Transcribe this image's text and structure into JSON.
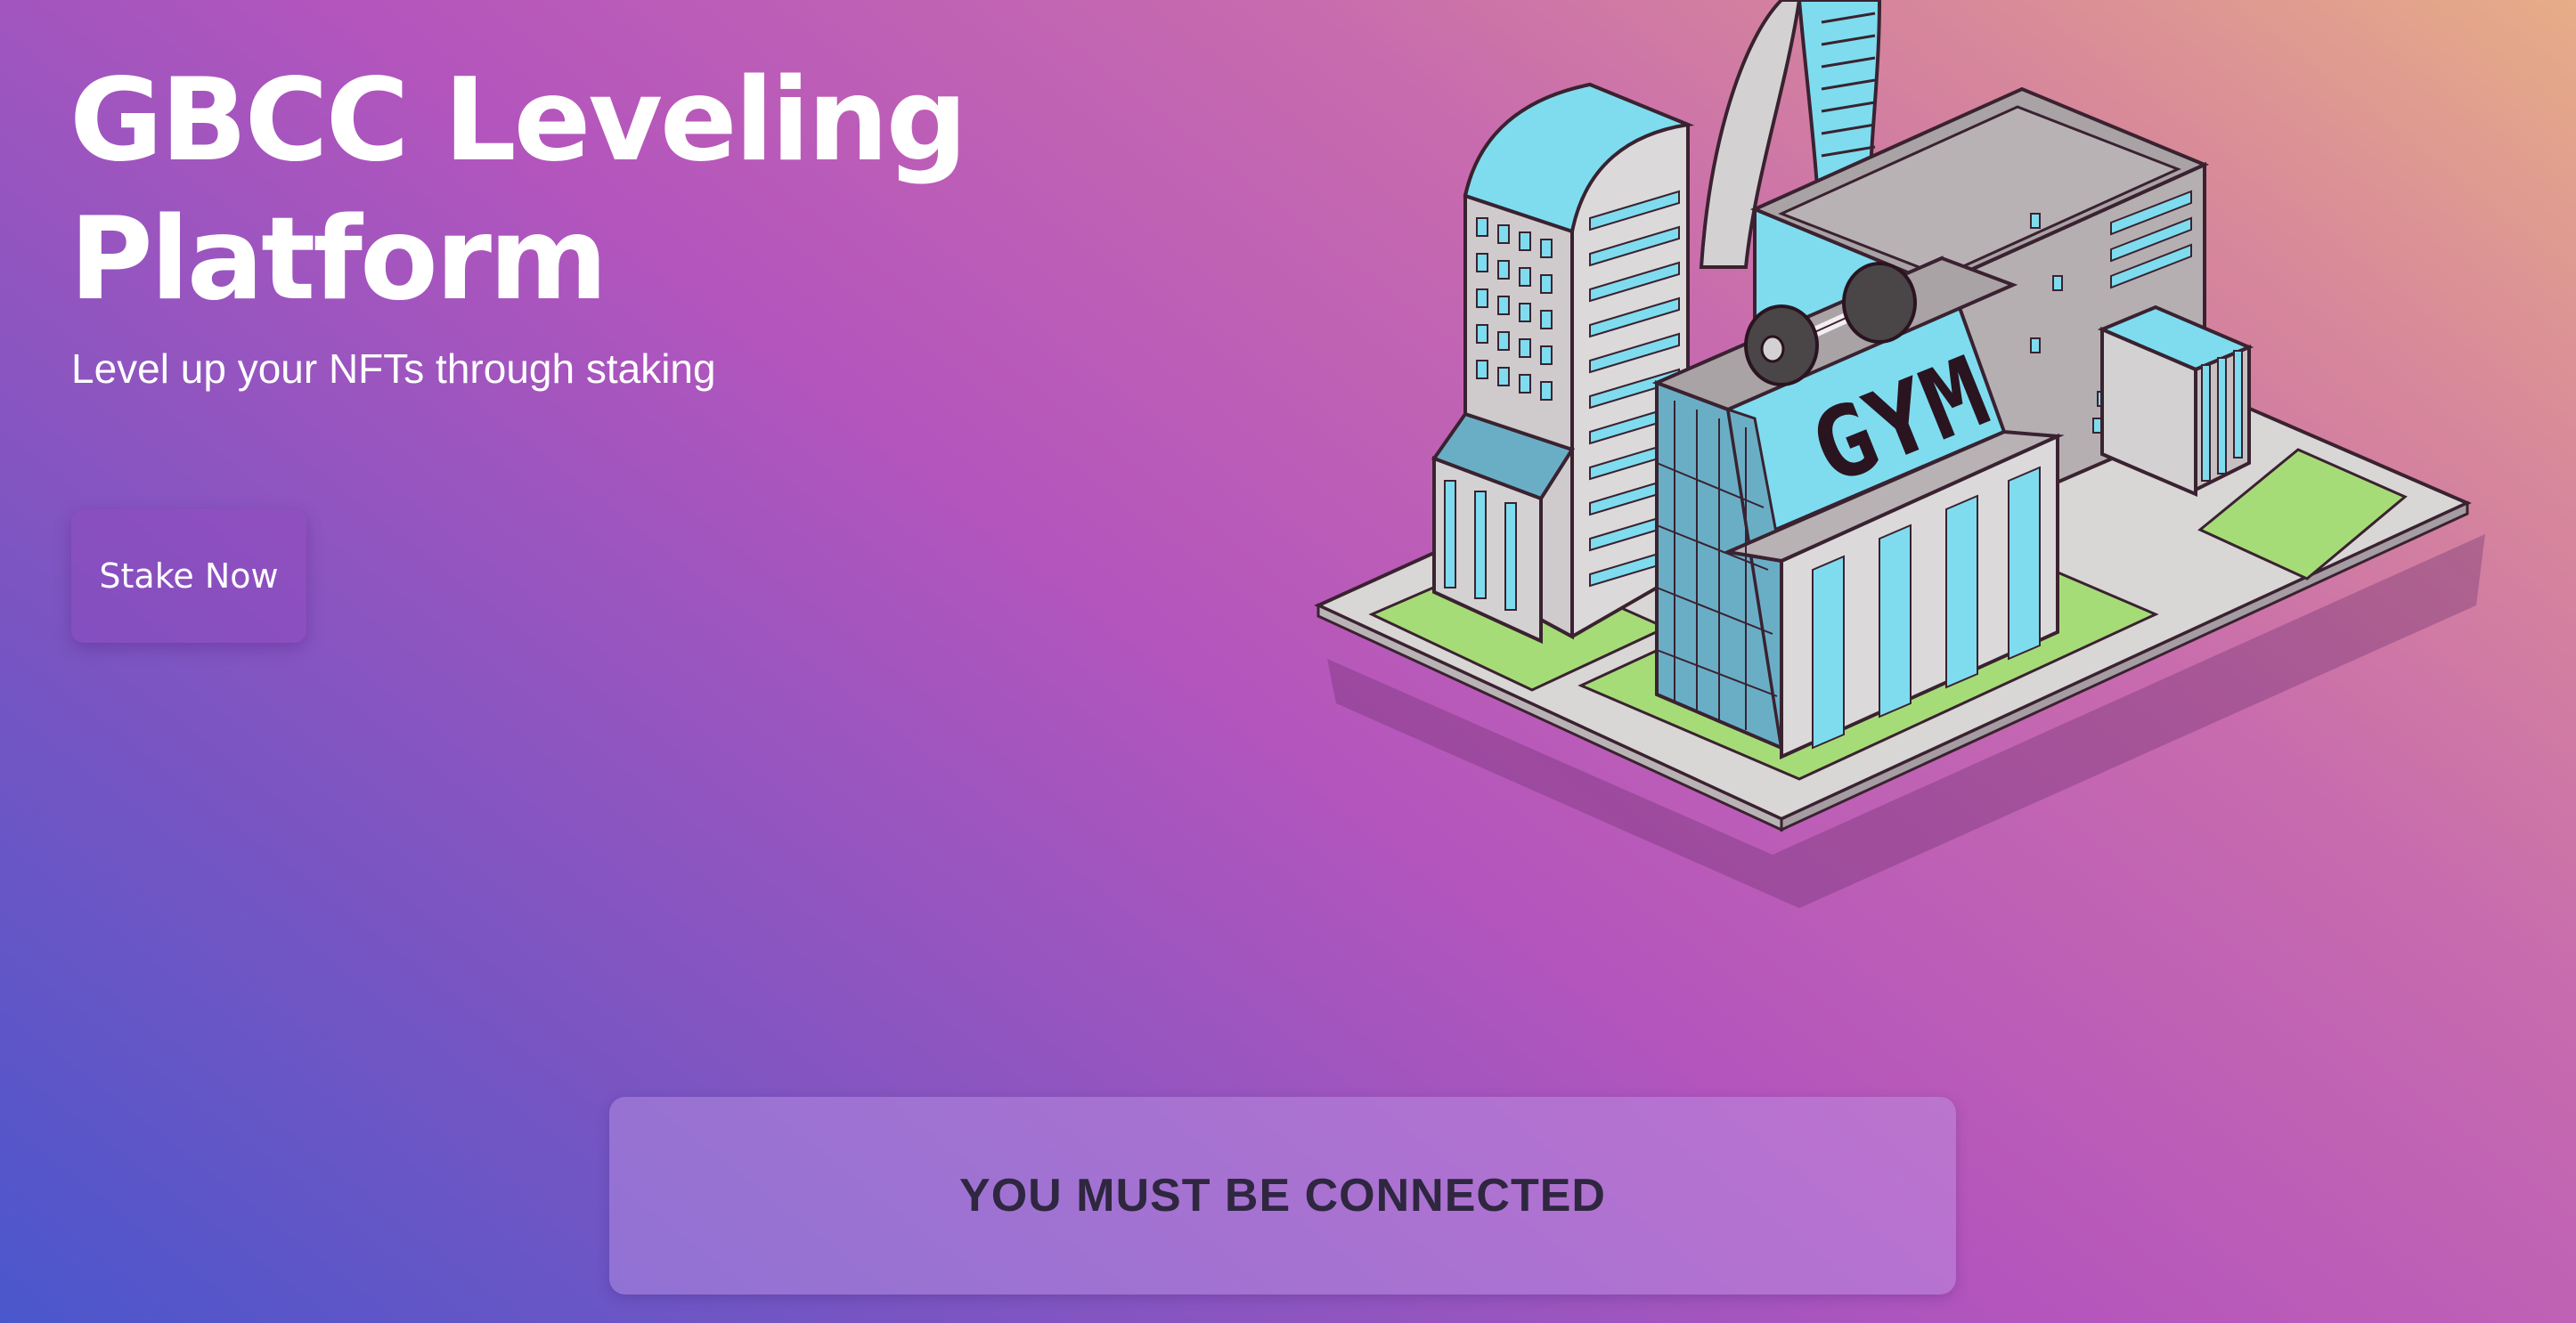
{
  "hero": {
    "title_line1": "GBCC Leveling",
    "title_line2": "Platform",
    "subtitle": "Level up your NFTs through staking",
    "cta_label": "Stake Now"
  },
  "illustration": {
    "sign_text": "GYM",
    "icon": "gym-city-illustration"
  },
  "notice": {
    "text": "YOU MUST BE CONNECTED"
  },
  "colors": {
    "gradient": [
      "#4a57cc",
      "#b455bd",
      "#e7ad87"
    ],
    "building_glass": "#7fdcef",
    "park_green": "#a6dc78"
  }
}
